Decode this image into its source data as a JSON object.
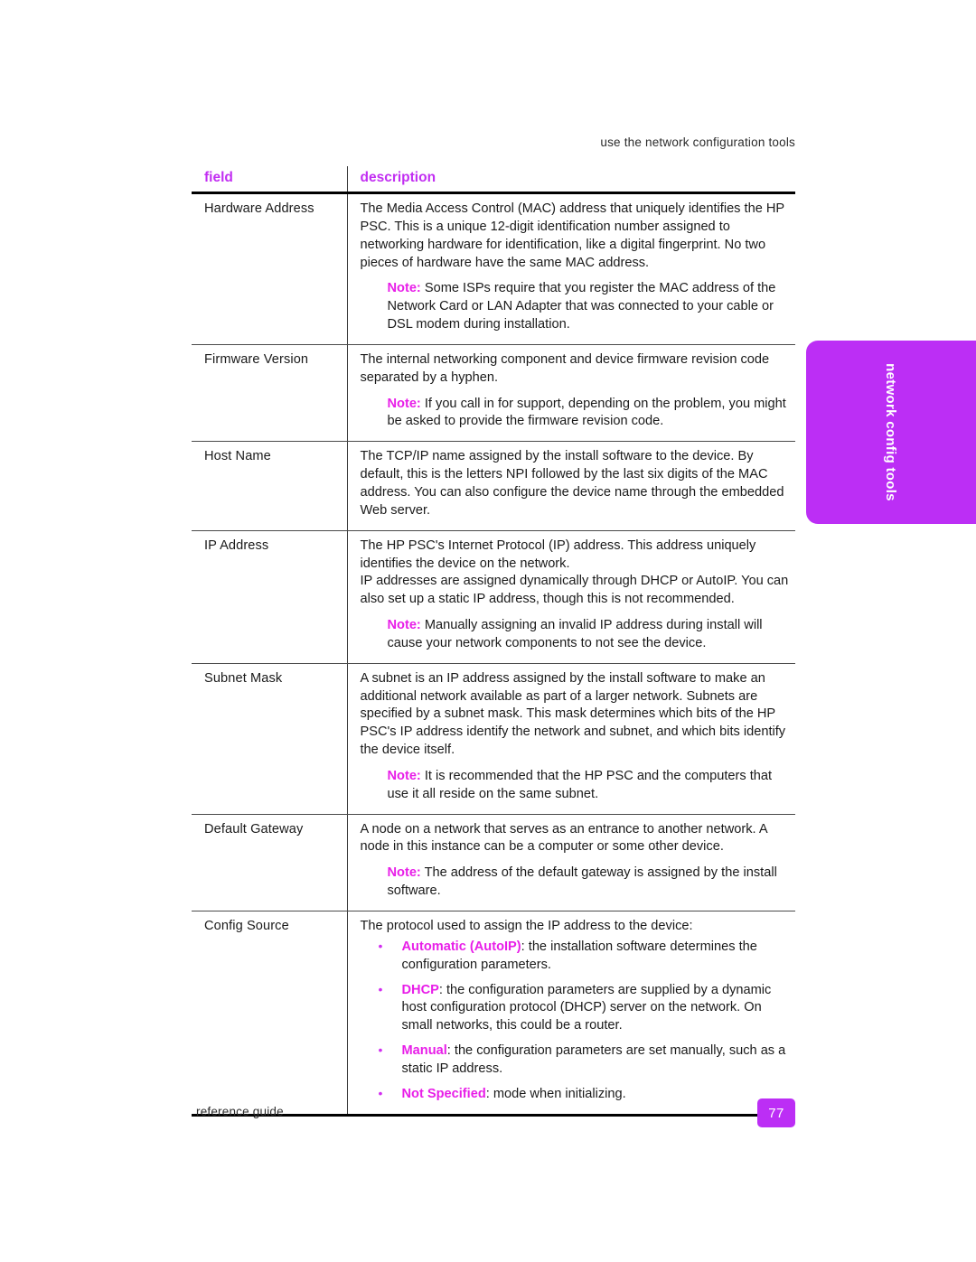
{
  "document": {
    "running_header": "use the network configuration tools",
    "side_tab_label": "network config tools",
    "footer_label": "reference guide",
    "page_number": "77"
  },
  "colors": {
    "accent_magenta": "#bc2ef5",
    "note_magenta": "#e81ee8",
    "header_magenta": "#c22ef2",
    "body_text": "#1a1a1a"
  },
  "table": {
    "headers": {
      "field": "field",
      "description": "description"
    },
    "rows": [
      {
        "field": "Hardware Address",
        "paragraphs": [
          "The Media Access Control (MAC) address that uniquely identifies the HP PSC. This is a unique 12-digit identification number assigned to networking hardware for identification, like a digital fingerprint. No two pieces of hardware have the same MAC address."
        ],
        "note_label": "Note:",
        "note_text": "Some ISPs require that you register the MAC address of the Network Card or LAN Adapter that was connected to your cable or DSL modem during installation."
      },
      {
        "field": "Firmware Version",
        "paragraphs": [
          "The internal networking component and device firmware revision code separated by a hyphen."
        ],
        "note_label": "Note:",
        "note_text": "If you call in for support, depending on the problem, you might be asked to provide the firmware revision code."
      },
      {
        "field": "Host Name",
        "paragraphs": [
          "The TCP/IP name assigned by the install software to the device. By default, this is the letters NPI followed by the last six digits of the MAC address. You can also configure the device name through the embedded Web server."
        ],
        "note_label": "",
        "note_text": ""
      },
      {
        "field": "IP Address",
        "paragraphs": [
          "The HP PSC's Internet Protocol (IP) address. This address uniquely identifies the device on the network.",
          "IP addresses are assigned dynamically through DHCP or AutoIP. You can also set up a static IP address, though this is not recommended."
        ],
        "note_label": "Note:",
        "note_text": "Manually assigning an invalid IP address during install will cause your network components to not see the device."
      },
      {
        "field": "Subnet Mask",
        "paragraphs": [
          "A subnet is an IP address assigned by the install software to make an additional network available as part of a larger network. Subnets are specified by a subnet mask. This mask determines which bits of the HP PSC's IP address identify the network and subnet, and which bits identify the device itself."
        ],
        "note_label": "Note:",
        "note_text": "It is recommended that the HP PSC and the computers that use it all reside on the same subnet."
      },
      {
        "field": "Default Gateway",
        "paragraphs": [
          "A node on a network that serves as an entrance to another network. A node in this instance can be a computer or some other device."
        ],
        "note_label": "Note:",
        "note_text": "The address of the default gateway is assigned by the install software."
      },
      {
        "field": "Config Source",
        "paragraphs": [
          "The protocol used to assign the IP address to the device:"
        ],
        "note_label": "",
        "note_text": "",
        "bullets": [
          {
            "term": "Automatic (AutoIP)",
            "text": ": the installation software determines the configuration parameters."
          },
          {
            "term": "DHCP",
            "text": ": the configuration parameters are supplied by a dynamic host configuration protocol (DHCP) server on the network. On small networks, this could be a router."
          },
          {
            "term": "Manual",
            "text": ": the configuration parameters are set manually, such as a static IP address."
          },
          {
            "term": "Not Specified",
            "text": ": mode when initializing."
          }
        ]
      }
    ]
  }
}
